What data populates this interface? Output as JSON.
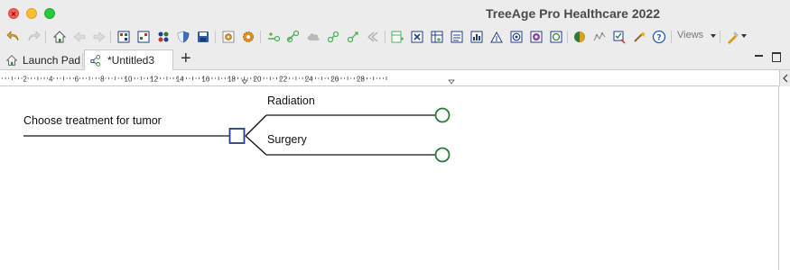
{
  "window": {
    "title": "TreeAge Pro Healthcare 2022"
  },
  "toolbar": {
    "icons": [
      "undo-icon",
      "redo-icon",
      "home-icon",
      "back-icon",
      "forward-icon",
      "move-icon",
      "grid-icon",
      "nodes-icon",
      "shield-icon",
      "save-icon",
      "settings-gear-icon",
      "gear-icon",
      "add-branch-icon",
      "add-node-icon",
      "cloud-icon",
      "link-icon",
      "insert-icon",
      "collapse-icon",
      "table-insert-icon",
      "excel-icon",
      "table-add-icon",
      "sheet-icon",
      "probability-icon",
      "markov-icon",
      "decision-icon",
      "chance-icon",
      "terminal-icon",
      "rollback-icon",
      "stats-icon",
      "wand-icon",
      "help-icon",
      "wizard-icon"
    ],
    "views_label": "Views"
  },
  "tabs": [
    {
      "label": "Launch Pad",
      "active": false
    },
    {
      "label": "*Untitled3",
      "active": true
    }
  ],
  "ruler": {
    "ticks": [
      "2",
      "4",
      "6",
      "8",
      "10",
      "12",
      "14",
      "16",
      "18",
      "20",
      "22",
      "24",
      "26",
      "28"
    ]
  },
  "tree": {
    "root_label": "Choose treatment for tumor",
    "branches": [
      {
        "label": "Radiation",
        "node": "chance"
      },
      {
        "label": "Surgery",
        "node": "chance"
      }
    ]
  },
  "colors": {
    "decision_node": "#1f3d8c",
    "chance_node": "#2d7a3c",
    "branch_line": "#111111"
  }
}
